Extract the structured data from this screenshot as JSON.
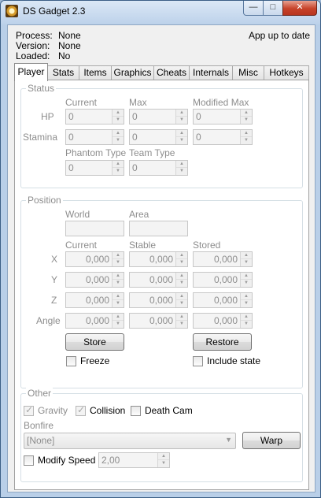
{
  "window": {
    "title": "DS Gadget 2.3",
    "min_symbol": "—",
    "max_symbol": "□",
    "close_symbol": "✕"
  },
  "info": {
    "process_label": "Process:",
    "process_value": "None",
    "version_label": "Version:",
    "version_value": "None",
    "loaded_label": "Loaded:",
    "loaded_value": "No",
    "update_status": "App up to date"
  },
  "tabs": [
    {
      "label": "Player",
      "active": true
    },
    {
      "label": "Stats"
    },
    {
      "label": "Items"
    },
    {
      "label": "Graphics"
    },
    {
      "label": "Cheats"
    },
    {
      "label": "Internals"
    },
    {
      "label": "Misc"
    },
    {
      "label": "Hotkeys"
    }
  ],
  "status": {
    "title": "Status",
    "col_current": "Current",
    "col_max": "Max",
    "col_modified_max": "Modified Max",
    "hp_label": "HP",
    "stamina_label": "Stamina",
    "hp_current": "0",
    "hp_max": "0",
    "hp_modified_max": "0",
    "stamina_current": "0",
    "stamina_max": "0",
    "stamina_modified_max": "0",
    "phantom_type_label": "Phantom Type",
    "team_type_label": "Team Type",
    "phantom_type": "0",
    "team_type": "0"
  },
  "position": {
    "title": "Position",
    "world_label": "World",
    "area_label": "Area",
    "col_current": "Current",
    "col_stable": "Stable",
    "col_stored": "Stored",
    "x_label": "X",
    "y_label": "Y",
    "z_label": "Z",
    "angle_label": "Angle",
    "x_current": "0,000",
    "x_stable": "0,000",
    "x_stored": "0,000",
    "y_current": "0,000",
    "y_stable": "0,000",
    "y_stored": "0,000",
    "z_current": "0,000",
    "z_stable": "0,000",
    "z_stored": "0,000",
    "angle_current": "0,000",
    "angle_stable": "0,000",
    "angle_stored": "0,000",
    "store_button": "Store",
    "restore_button": "Restore",
    "freeze_label": "Freeze",
    "include_state_label": "Include state"
  },
  "other": {
    "title": "Other",
    "gravity_label": "Gravity",
    "gravity_checked": true,
    "collision_label": "Collision",
    "collision_checked": true,
    "death_cam_label": "Death Cam",
    "death_cam_checked": false,
    "bonfire_label": "Bonfire",
    "bonfire_value": "[None]",
    "warp_button": "Warp",
    "modify_speed_label": "Modify Speed",
    "modify_speed_checked": false,
    "speed_value": "2,00"
  }
}
